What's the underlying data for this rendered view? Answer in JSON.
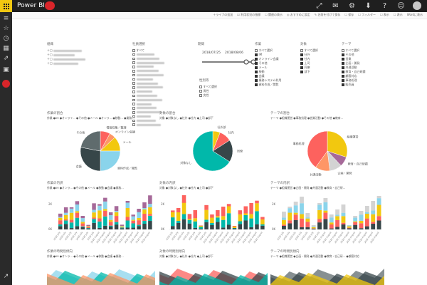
{
  "app": {
    "title": "Power BI"
  },
  "topbar_icons": [
    "expand-icon",
    "message-icon",
    "download-icon",
    "help-icon",
    "feedback-icon"
  ],
  "colors": {
    "topbar": "#1f1f1f",
    "waffle": "#f2c811",
    "badge_red": "#d9252a",
    "palette": [
      "#374649",
      "#01b8aa",
      "#fd625e",
      "#f2c80f",
      "#5f6b6d",
      "#8ad4eb",
      "#fe9666",
      "#a66999",
      "#d3d3d3",
      "#2f6fd0"
    ]
  },
  "actions": [
    "＋ライブの追加",
    "☑ 利用状況の指標",
    "☐ 関連の表示",
    "◎ おすすめに設定",
    "✎ 名前を付けて保存",
    "☐ 保存",
    "☐ フィルター",
    "☐ 表示",
    "☐ 表示",
    "Wordに表示"
  ],
  "slicers": {
    "org": {
      "title": "組織",
      "items": [
        "＋□",
        "＋□",
        "＋□",
        "＋□"
      ]
    },
    "employee": {
      "title": "社員選択",
      "items": [
        "すべて",
        "",
        "",
        "",
        "",
        "",
        "",
        "",
        "",
        "",
        "",
        "",
        "",
        "",
        "",
        "",
        "",
        "",
        ""
      ]
    },
    "period": {
      "title": "期間",
      "start": "2018/07/25",
      "end": "2018/08/06"
    },
    "attribute": {
      "title": "性別等",
      "items": [
        "すべて選択",
        "男性",
        "女性"
      ]
    },
    "work": {
      "title": "作業",
      "items": [
        "すべて選択",
        "IM",
        "オンライン会議",
        "その他",
        "メール",
        "移動",
        "会議",
        "業務システム利用",
        "資料作成／閲覧"
      ]
    },
    "target": {
      "title": "対象",
      "items": [
        "すべて選択",
        "社外",
        "社内",
        "上司",
        "同僚",
        "部下"
      ]
    },
    "theme": {
      "title": "テーマ",
      "items": [
        "すべて選択",
        "その他",
        "営業",
        "企画・開発",
        "共通活動",
        "教育・自己研鑽",
        "顧客対応",
        "事務処理",
        "販売員"
      ]
    }
  },
  "visuals": {
    "pie1": {
      "title": "作業の割合",
      "legend": "作業 ●IM ●オンライ... ●その他 ●メール ●オンラ... ●移動... ●業務...",
      "labels": [
        "情報収集／整理",
        "オンライン会議",
        "メール",
        "資料作成／閲覧",
        "会議",
        "その他"
      ]
    },
    "pie2": {
      "title": "対象の割合",
      "legend": "対象 ●対象なし ●社外 ●社内 ●上司 ●部下",
      "labels": [
        "社外部",
        "社内",
        "同僚",
        "対象なし"
      ]
    },
    "pie3": {
      "title": "テーマの割合",
      "legend": "テーマ ●組織運営 ●事務処理 ●営業活動 ●その他 ●教育...",
      "labels": [
        "組織運営",
        "教育・自己研鑽",
        "企画・開発",
        "共通活動",
        "組織運営",
        "事務処理"
      ]
    },
    "bar1": {
      "title": "作業の内訳",
      "legend": "作業 ●IM ●オンラ... ●その他 ●メール ●移動 ●会議 ●業務..."
    },
    "bar2": {
      "title": "対象の内訳",
      "legend": "対象 ●対象なし ●社外 ●社内 ●上司 ●部下"
    },
    "bar3": {
      "title": "テーマの内訳",
      "legend": "テーマ ●組織運営 ●企画・開発 ●共通活動 ●教育・自己研..."
    },
    "area1": {
      "title": "作業の時間別傾向",
      "legend": "作業 ●IM ●オンラ... ●その他 ●メール ●移動 ●会議 ●業務..."
    },
    "area2": {
      "title": "対象の時間別傾向",
      "legend": "対象 ●対象なし ●社外 ●社内 ●上司 ●部下"
    },
    "area3": {
      "title": "テーマの時間別傾向",
      "legend": "テーマ ●組織運営 ●企画・開発 ●共通活動 ●教育・自己研... ●顧客対応"
    }
  },
  "chart_data": [
    {
      "type": "pie",
      "title": "作業の割合",
      "labels": [
        "情報収集／整理",
        "オンライン会議",
        "メール",
        "資料作成／閲覧",
        "会議",
        "その他"
      ],
      "values": [
        8,
        5,
        12,
        25,
        28,
        22
      ]
    },
    {
      "type": "pie",
      "title": "対象の割合",
      "labels": [
        "社外部",
        "社内",
        "同僚",
        "対象なし"
      ],
      "values": [
        6,
        10,
        18,
        66
      ]
    },
    {
      "type": "pie",
      "title": "テーマの割合",
      "labels": [
        "組織運営",
        "教育・自己研鑽",
        "企画・開発",
        "共通活動",
        "事務処理"
      ],
      "values": [
        30,
        8,
        10,
        12,
        40
      ]
    },
    {
      "type": "bar",
      "title": "作業の内訳",
      "yticks": [
        "2K",
        "0K"
      ],
      "n": 17
    },
    {
      "type": "bar",
      "title": "対象の内訳",
      "yticks": [
        "2K",
        "0K"
      ],
      "n": 17
    },
    {
      "type": "bar",
      "title": "テーマの内訳",
      "yticks": [
        "2K",
        "0K"
      ],
      "n": 17
    },
    {
      "type": "area",
      "title": "作業の時間別傾向"
    },
    {
      "type": "area",
      "title": "対象の時間別傾向"
    },
    {
      "type": "area",
      "title": "テーマの時間別傾向"
    }
  ]
}
